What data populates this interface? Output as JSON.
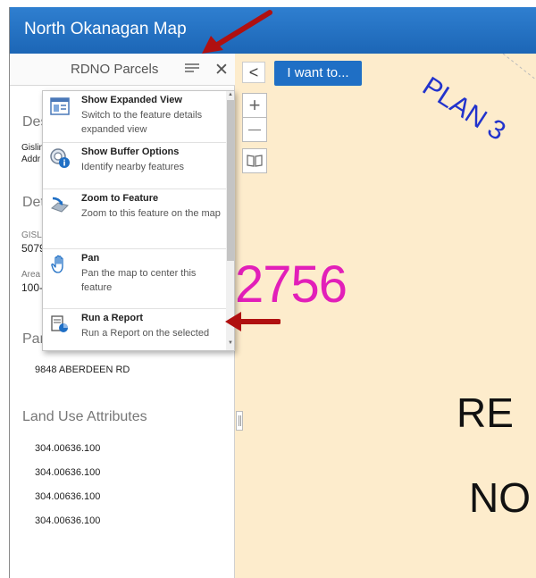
{
  "app": {
    "title": "North Okanagan Map"
  },
  "panel": {
    "title": "RDNO Parcels",
    "sections": {
      "des": "Des",
      "det": "Det",
      "par": "Par",
      "land_use": "Land Use Attributes"
    },
    "fields": {
      "gislink_1": "Gislin",
      "addr_1": "Addr",
      "gislink_2": "GISLI",
      "gislink_value": "5079",
      "area_label": "Area",
      "area_value": "100-"
    },
    "address": "9848 ABERDEEN RD",
    "land_use_items": [
      "304.00636.100",
      "304.00636.100",
      "304.00636.100",
      "304.00636.100"
    ]
  },
  "menu": {
    "items": [
      {
        "label": "Show Expanded View",
        "desc": "Switch to the feature details expanded view",
        "icon": "expanded-view-icon"
      },
      {
        "label": "Show Buffer Options",
        "desc": "Identify nearby features",
        "icon": "buffer-icon"
      },
      {
        "label": "Zoom to Feature",
        "desc": "Zoom to this feature on the map",
        "icon": "zoom-to-feature-icon"
      },
      {
        "label": "Pan",
        "desc": "Pan the map to center this feature",
        "icon": "hand-pan-icon"
      },
      {
        "label": "Run a Report",
        "desc": "Run a Report on the selected",
        "icon": "report-icon"
      }
    ]
  },
  "toolbar": {
    "collapse_symbol": "<",
    "i_want_to": "I want to...",
    "zoom_in": "+",
    "zoom_out": "—"
  },
  "map": {
    "parcel_number": "2756",
    "label_line_1": "RE",
    "label_line_2": "NO",
    "plan_label": "PLAN 3"
  },
  "colors": {
    "header": "#1c66b6",
    "map_background": "#fdeccc",
    "parcel_number": "#e21fb9",
    "annotation_arrow": "#b01010"
  }
}
